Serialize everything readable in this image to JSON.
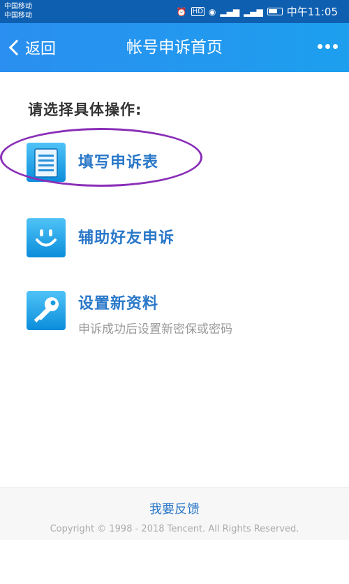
{
  "status_bar": {
    "carrier_1": "中国移动",
    "carrier_2": "中国移动",
    "time": "中午11:05",
    "icons": [
      "alarm-icon",
      "hd-icon",
      "eye-icon",
      "signal-4g-icon",
      "signal-2g-icon",
      "battery-icon"
    ]
  },
  "nav": {
    "back_label": "返回",
    "title": "帐号申诉首页"
  },
  "main": {
    "prompt": "请选择具体操作:",
    "options": [
      {
        "label": "填写申诉表",
        "icon": "form-icon"
      },
      {
        "label": "辅助好友申诉",
        "icon": "smiley-icon"
      },
      {
        "label": "设置新资料",
        "sublabel": "申诉成功后设置新密保或密码",
        "icon": "key-icon"
      }
    ]
  },
  "footer": {
    "feedback": "我要反馈",
    "copyright": "Copyright © 1998 - 2018 Tencent. All Rights Reserved."
  },
  "colors": {
    "accent": "#2a78c8",
    "nav": "#1d9fee",
    "annotation": "#8a2fb8"
  }
}
